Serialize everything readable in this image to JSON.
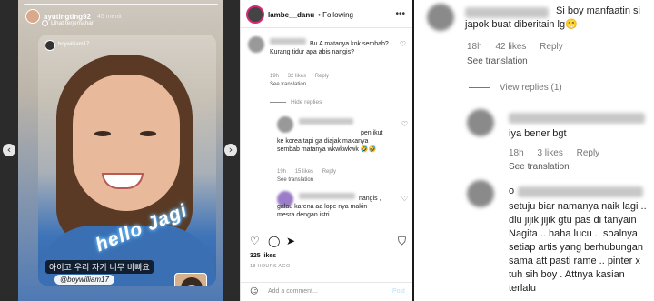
{
  "story": {
    "username": "ayutingting92",
    "time": "45 menit",
    "translate_link": "Lihat terjemahan",
    "inner_username": "boywilliam17",
    "hello_sticker": "hello Jagi",
    "korean_caption": "아이고 우리 자기 너무 바빠요",
    "mention_sticker": "@boywilliam17",
    "prev_arrow": "‹",
    "next_arrow": "›"
  },
  "post": {
    "username": "lambe__danu",
    "following": "Following",
    "more_icon": "•••",
    "comments": [
      {
        "text": "Bu A matanya kok sembab? Kurang tidur apa abis nangis?",
        "time": "19h",
        "likes": "32 likes",
        "reply": "Reply",
        "translate": "See translation"
      },
      {
        "text": "pen ikut ke korea tapi ga diajak makanya sembab matanya wkwkwkwk 🤣🤣",
        "time": "19h",
        "likes": "15 likes",
        "reply": "Reply",
        "translate": "See translation"
      },
      {
        "text": "nangis , galau karena aa lope nya makin mesra dengan istri"
      }
    ],
    "hide_replies": "Hide replies",
    "likes_count": "325 likes",
    "post_time": "18 HOURS AGO",
    "add_comment_placeholder": "Add a comment...",
    "post_button": "Post"
  },
  "zoom": {
    "comment1": {
      "text": "Si boy manfaatin si japok buat diberitain lg😁",
      "time": "18h",
      "likes": "42 likes",
      "reply": "Reply",
      "translate": "See translation"
    },
    "view_replies": "View replies (1)",
    "comment2": {
      "text": "iya bener bgt",
      "time": "18h",
      "likes": "3 likes",
      "reply": "Reply",
      "translate": "See translation"
    },
    "comment3": {
      "text": "setuju biar namanya naik lagi .. dlu jijik jijik gtu pas di tanyain Nagita .. haha lucu .. soalnya setiap artis yang berhubungan sama att pasti rame .. pinter x tuh sih boy . Attnya kasian terlalu",
      "name_prefix": "o"
    }
  }
}
